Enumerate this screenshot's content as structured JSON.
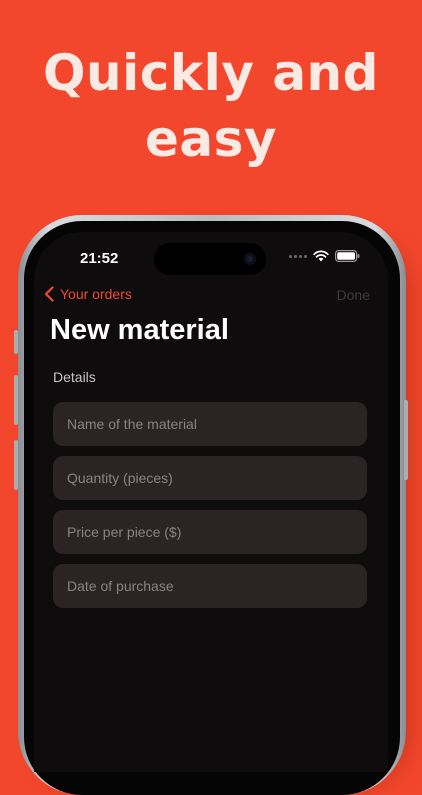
{
  "headline": {
    "line1": "Quickly and",
    "line2": "easy"
  },
  "status_bar": {
    "time": "21:52",
    "icons": [
      "signal-dots-icon",
      "wifi-icon",
      "battery-icon"
    ]
  },
  "nav": {
    "back_label": "Your orders",
    "done_label": "Done"
  },
  "page": {
    "title": "New material",
    "section_label": "Details"
  },
  "form": {
    "fields": [
      {
        "placeholder": "Name of the material",
        "value": ""
      },
      {
        "placeholder": "Quantity (pieces)",
        "value": ""
      },
      {
        "placeholder": "Price per piece ($)",
        "value": ""
      },
      {
        "placeholder": "Date of purchase",
        "value": ""
      }
    ]
  },
  "colors": {
    "background": "#f2472c",
    "accent": "#ee4a30",
    "screen": "#0e0c0c",
    "field": "#2a2424"
  }
}
